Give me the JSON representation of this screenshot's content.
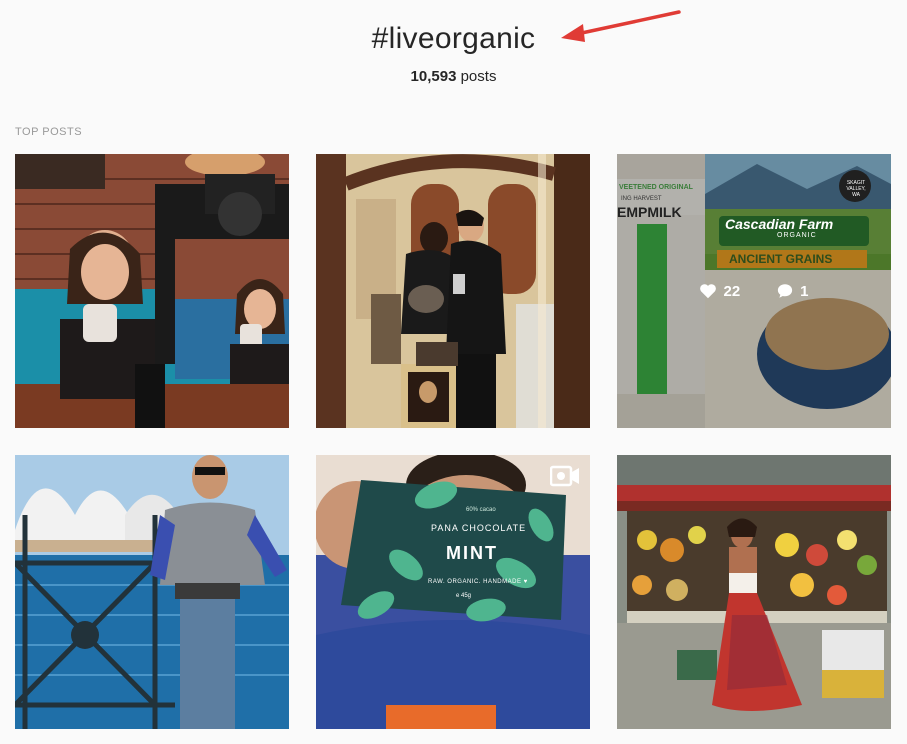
{
  "header": {
    "hashtag": "#liveorganic",
    "post_count": "10,593",
    "post_count_suffix": "posts",
    "arrow_color": "#e03b35"
  },
  "section": {
    "label": "TOP POSTS"
  },
  "posts": [
    {
      "id": 1,
      "subject": "two women drinking coffee with camera"
    },
    {
      "id": 2,
      "subject": "couple mirror selfie"
    },
    {
      "id": 3,
      "subject": "hempmilk and ancient grains cereal",
      "likes": "22",
      "comments": "1",
      "carton_text_1": "VEETENED ORIGINAL",
      "carton_text_2": "ING HARVEST",
      "carton_text_3": "EMPMILK",
      "cereal_brand": "Cascadian Farm",
      "cereal_organic": "ORGANIC",
      "cereal_name": "ANCIENT GRAINS",
      "cereal_badge": "SKAGIT VALLEY, WA"
    },
    {
      "id": 4,
      "subject": "man at Sydney Opera House"
    },
    {
      "id": 5,
      "subject": "mint chocolate bar",
      "is_video": true,
      "pack_cacao": "60% cacao",
      "pack_brand": "PANA CHOCOLATE",
      "pack_flavor": "MINT",
      "pack_tagline": "RAW. ORGANIC. HANDMADE ♥",
      "pack_weight": "e 45g"
    },
    {
      "id": 6,
      "subject": "woman at fruit market"
    }
  ],
  "icons": {
    "heart": "heart-icon",
    "comment": "comment-icon",
    "video": "video-camera-icon"
  }
}
